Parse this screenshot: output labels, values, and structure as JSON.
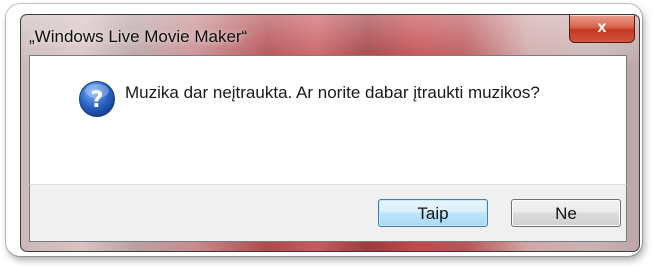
{
  "dialog": {
    "title": "„Windows Live Movie Maker“",
    "close_label": "x",
    "message": "Muzika dar neįtraukta. Ar norite dabar įtraukti muzikos?",
    "icon": "question-icon",
    "buttons": {
      "yes_label": "Taip",
      "no_label": "Ne"
    }
  },
  "colors": {
    "close_button": "#c2381f",
    "question_icon": "#2a64c5",
    "default_button_border": "#3c7fb1"
  }
}
